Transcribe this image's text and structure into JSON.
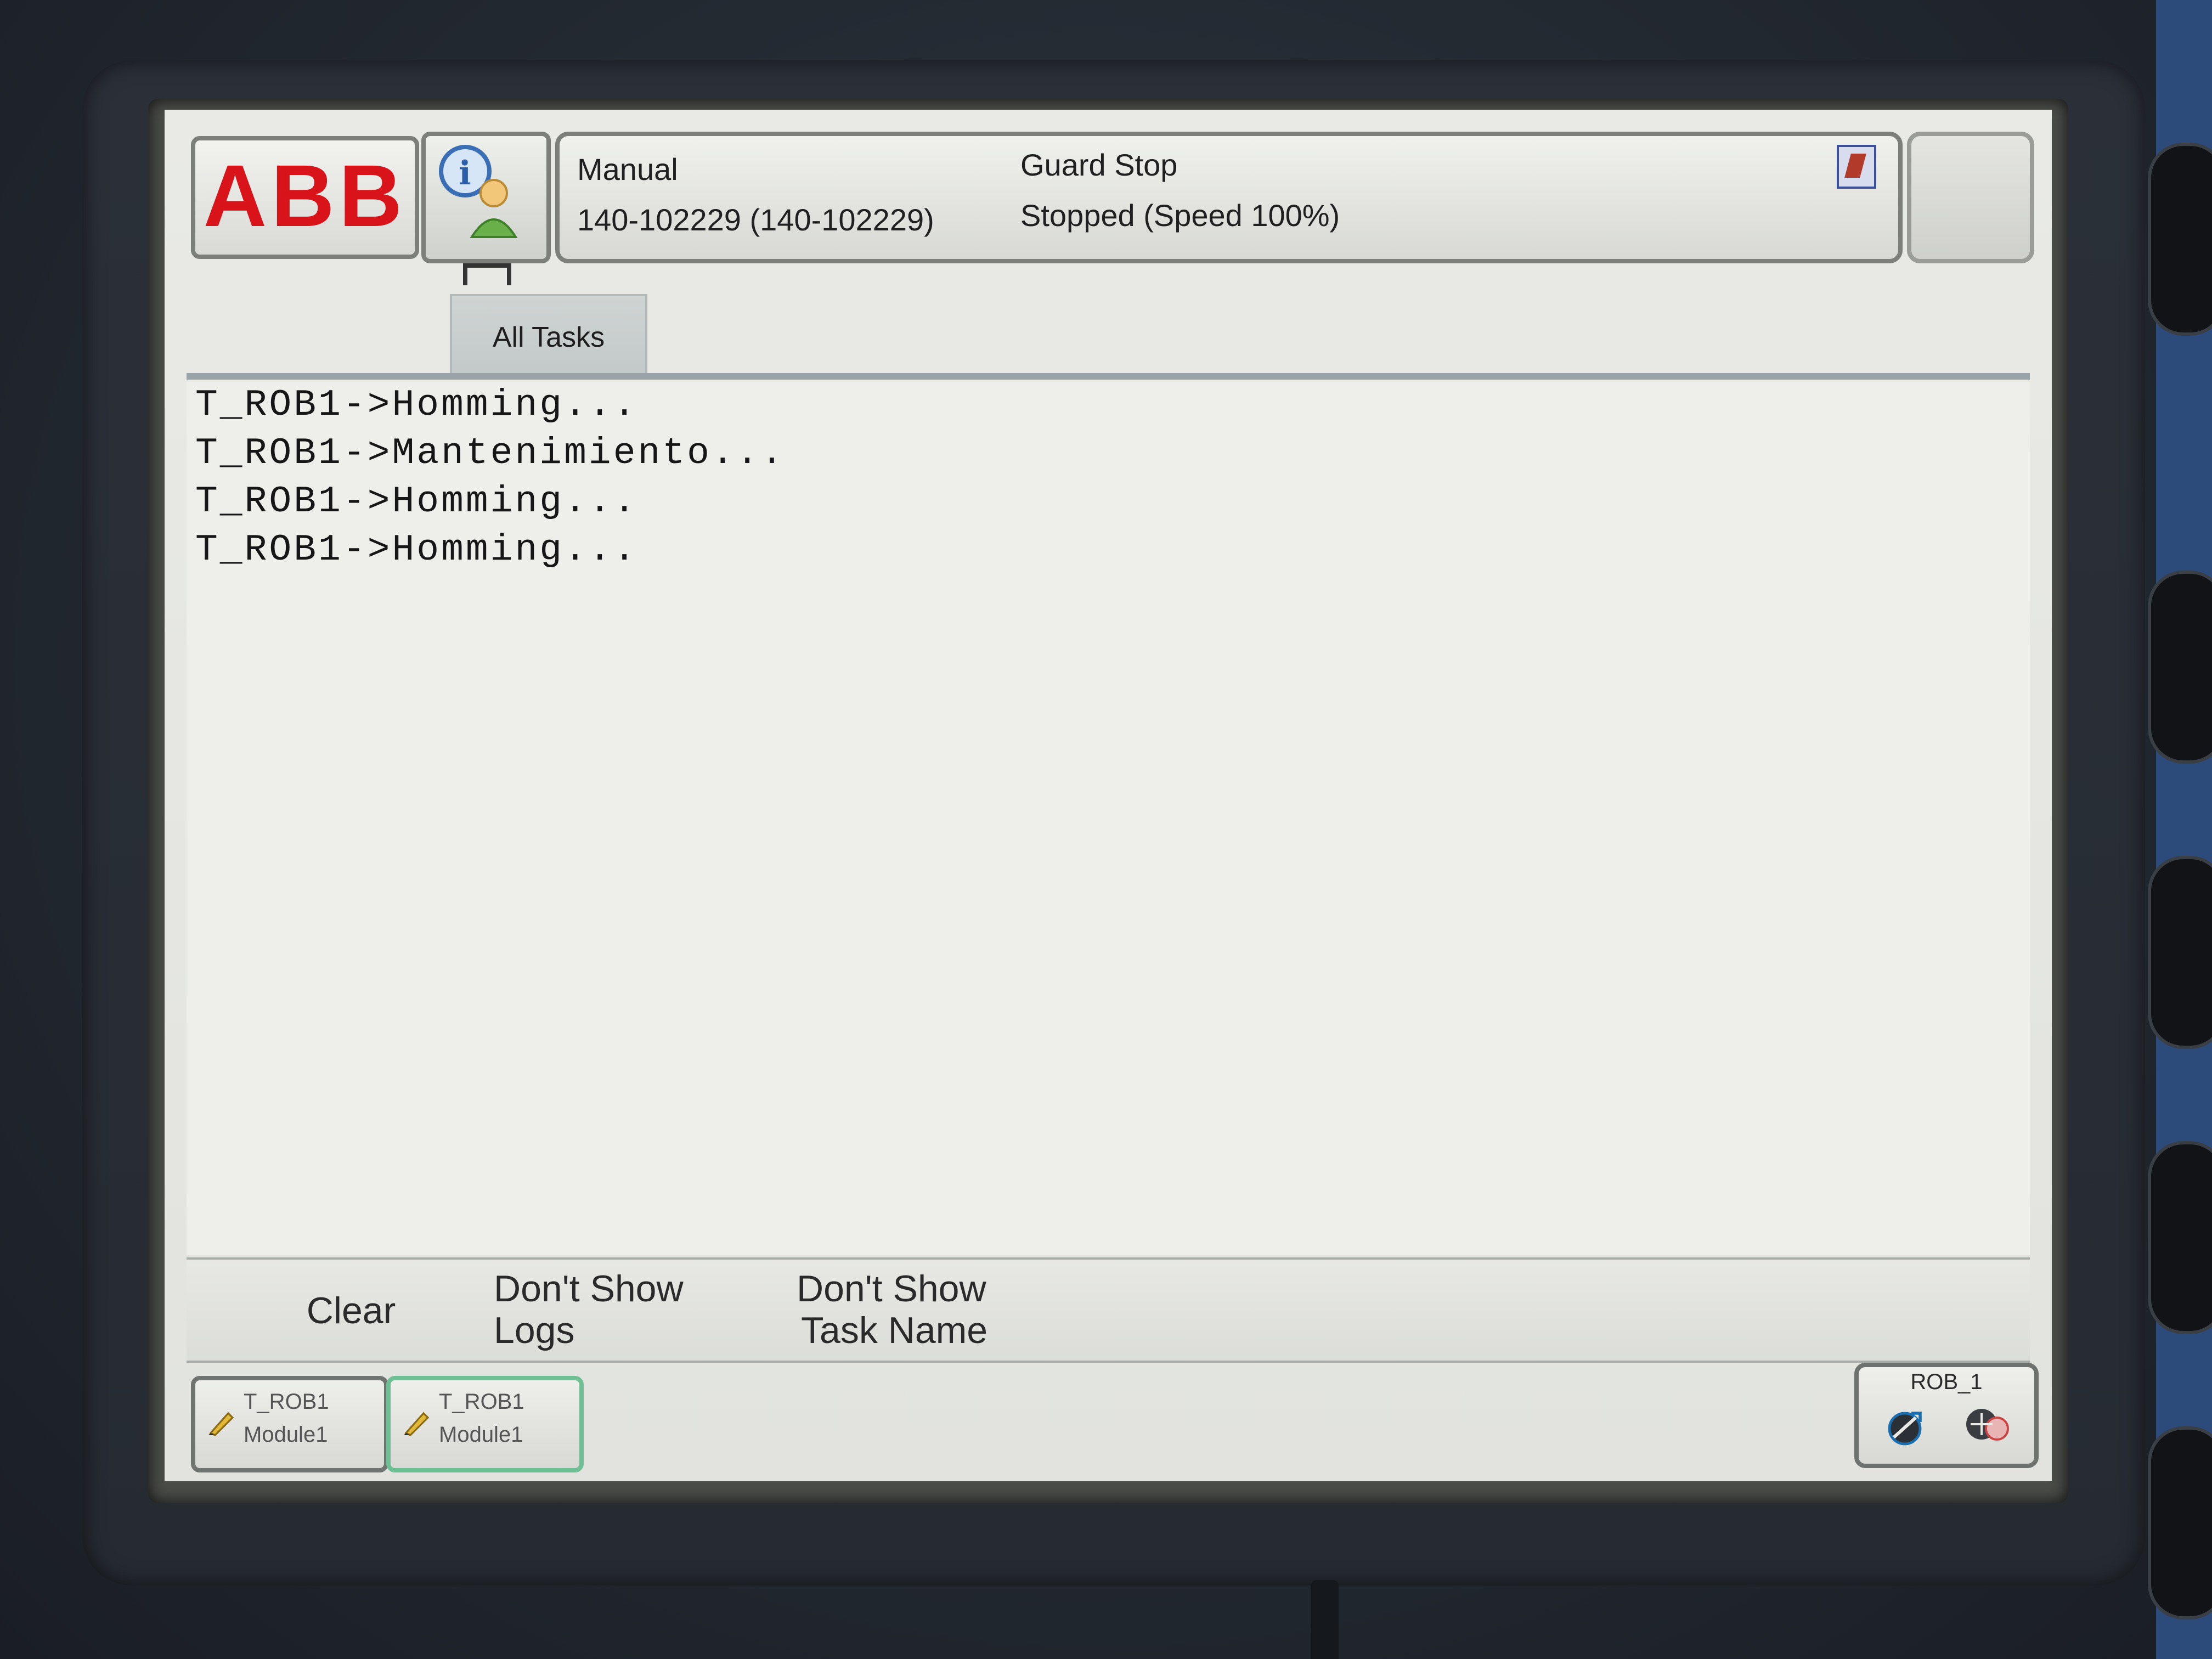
{
  "header": {
    "logo_text": "ABB",
    "mode": "Manual",
    "controller": "140-102229 (140-102229)",
    "safety_state": "Guard Stop",
    "run_state": "Stopped (Speed 100%)"
  },
  "tabs": [
    {
      "label": "All Tasks"
    }
  ],
  "log_lines": [
    "T_ROB1->Homming...",
    "T_ROB1->Mantenimiento...",
    "T_ROB1->Homming...",
    "T_ROB1->Homming..."
  ],
  "commands": {
    "clear": "Clear",
    "dont_show_logs_1": "Don't Show",
    "dont_show_logs_2": "Logs",
    "dont_show_task_1": "Don't Show",
    "dont_show_task_2": "Task Name"
  },
  "taskbar": [
    {
      "task": "T_ROB1",
      "module": "Module1"
    },
    {
      "task": "T_ROB1",
      "module": "Module1"
    }
  ],
  "mech_unit": {
    "label": "ROB_1"
  },
  "colors": {
    "abb_red": "#d8131a",
    "active_task_border": "#6fbf95",
    "screen_bg": "#e9eae6"
  }
}
